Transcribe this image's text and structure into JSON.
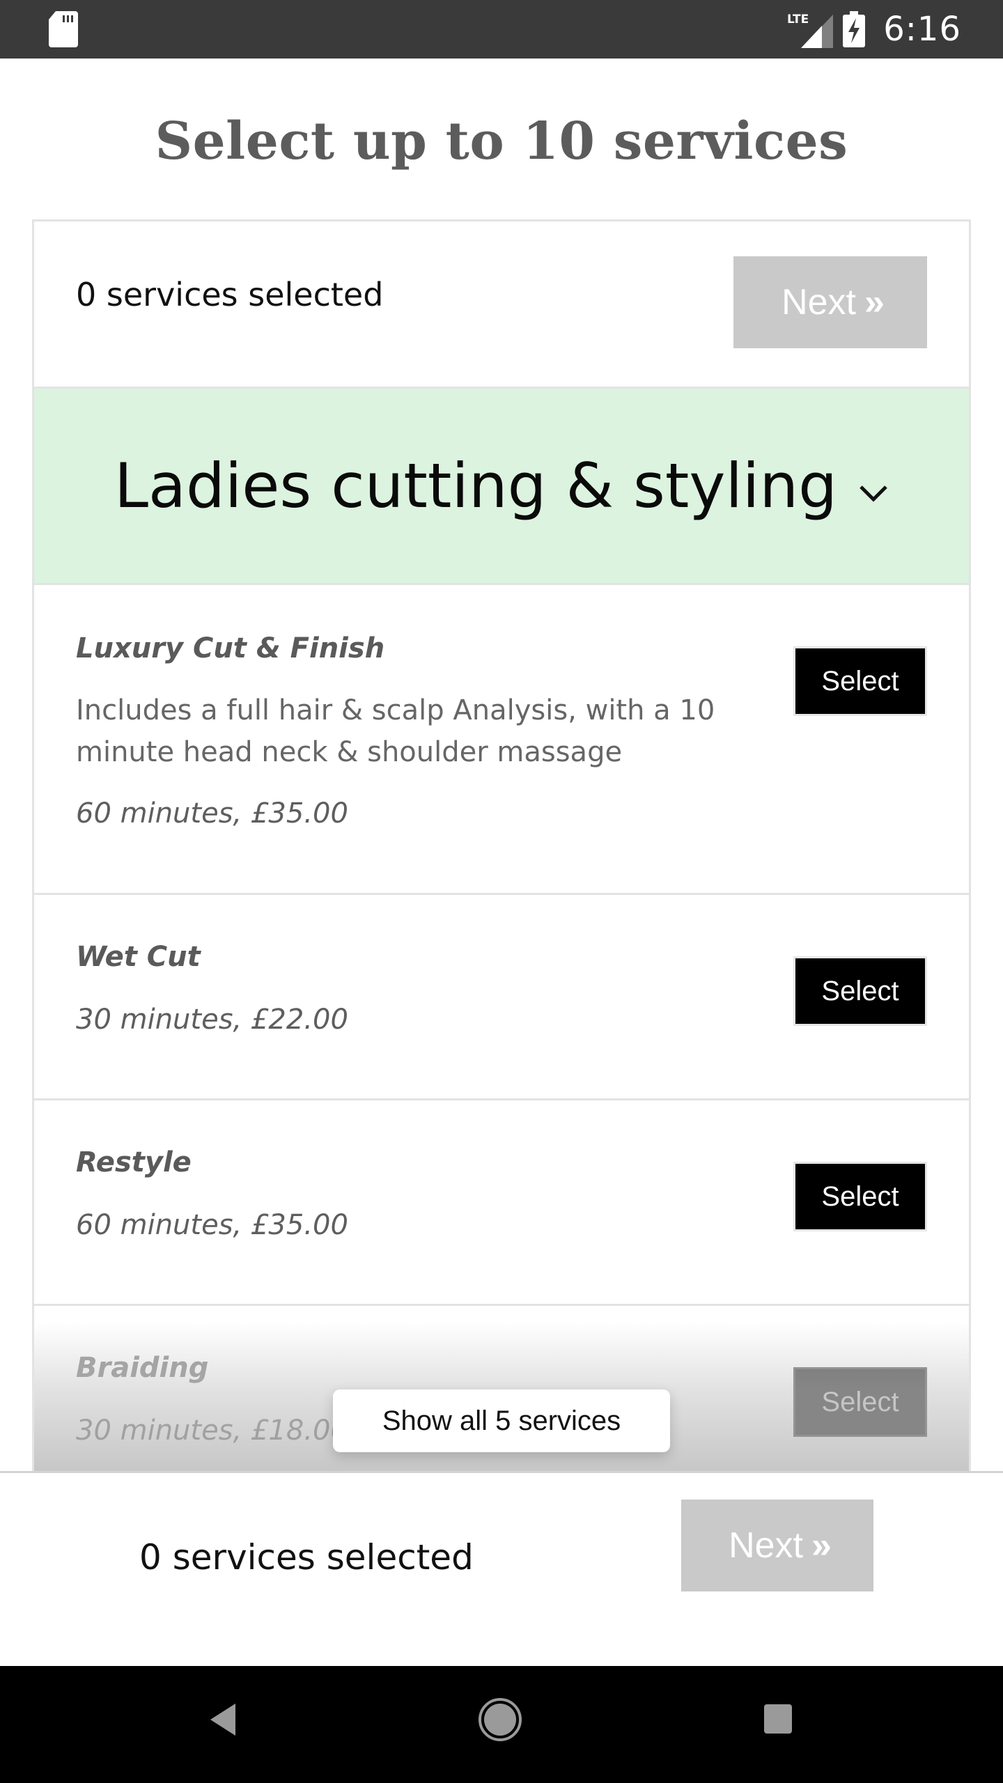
{
  "status_bar": {
    "time": "6:16",
    "network_label": "LTE",
    "icons": [
      "sd-card-icon",
      "lte-signal-icon",
      "battery-charging-icon"
    ]
  },
  "page": {
    "title": "Select up to 10 services"
  },
  "selection_bar_top": {
    "count_text": "0 services selected",
    "next_label": "Next",
    "next_icon": "double-chevron-right-icon",
    "next_enabled": false
  },
  "category": {
    "title": "Ladies cutting & styling",
    "icon": "chevron-down-icon",
    "header_color": "#dcf3df"
  },
  "services": [
    {
      "name": "Luxury Cut & Finish",
      "description": "Includes a full hair & scalp Analysis, with a 10 minute head neck & shoulder massage",
      "meta": "60 minutes, £35.00",
      "button_label": "Select"
    },
    {
      "name": "Wet Cut",
      "description": "",
      "meta": "30 minutes, £22.00",
      "button_label": "Select"
    },
    {
      "name": "Restyle",
      "description": "",
      "meta": "60 minutes, £35.00",
      "button_label": "Select"
    },
    {
      "name": "Braiding",
      "description": "",
      "meta": "30 minutes, £18.00",
      "button_label": "Select"
    }
  ],
  "show_all": {
    "label": "Show all 5 services"
  },
  "selection_bar_bottom": {
    "count_text": "0 services selected",
    "next_label": "Next",
    "next_icon": "double-chevron-right-icon",
    "next_enabled": false
  },
  "nav_bar": {
    "buttons": [
      "back-icon",
      "home-icon",
      "recents-icon"
    ]
  }
}
